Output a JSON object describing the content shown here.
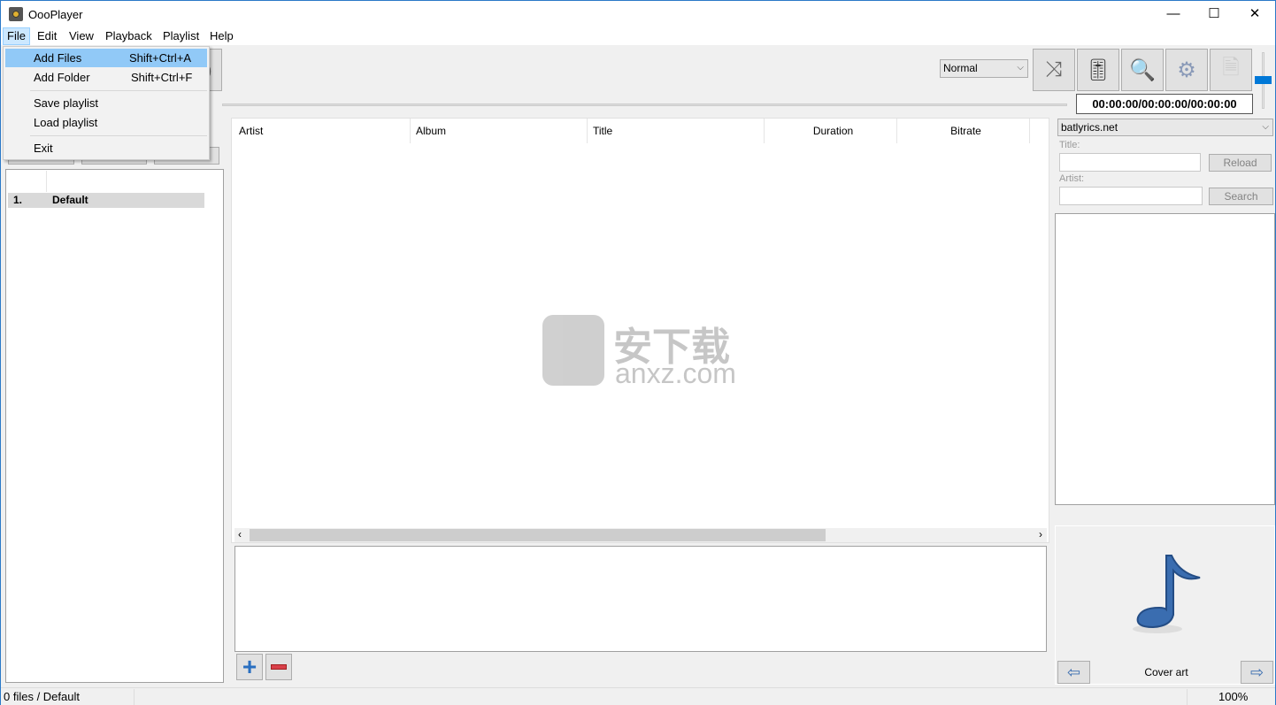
{
  "window": {
    "title": "OooPlayer",
    "minimize": "—",
    "maximize": "☐",
    "close": "✕"
  },
  "menu": [
    {
      "label": "File"
    },
    {
      "label": "Edit"
    },
    {
      "label": "View"
    },
    {
      "label": "Playback"
    },
    {
      "label": "Playlist"
    },
    {
      "label": "Help"
    }
  ],
  "file_menu": [
    {
      "label": "Add Files",
      "shortcut": "Shift+Ctrl+A"
    },
    {
      "label": "Add Folder",
      "shortcut": "Shift+Ctrl+F"
    },
    {
      "label": "Save playlist"
    },
    {
      "label": "Load playlist"
    },
    {
      "label": "Exit"
    }
  ],
  "toolbar": {
    "mode": "Normal",
    "time": "00:00:00/00:00:00/00:00:00",
    "icons": [
      "shuffle-icon",
      "equalizer-icon",
      "search-icon",
      "settings-icon",
      "document-icon"
    ],
    "volume": 0.5
  },
  "playlists": {
    "rows": [
      {
        "index": "1.",
        "name": "Default"
      }
    ]
  },
  "tracks": {
    "columns": [
      "Artist",
      "Album",
      "Title",
      "Duration",
      "Bitrate"
    ]
  },
  "lyrics": {
    "source": "batlyrics.net",
    "title_label": "Title:",
    "artist_label": "Artist:",
    "reload": "Reload",
    "search": "Search",
    "title_value": "",
    "artist_value": ""
  },
  "cover": {
    "label": "Cover art"
  },
  "status": {
    "left": "0 files / Default",
    "right": "100%"
  },
  "watermark": {
    "text": "安下载",
    "sub": "anxz.com"
  },
  "colors": {
    "accent": "#0078d7",
    "menu_highlight": "#91c9f7"
  }
}
